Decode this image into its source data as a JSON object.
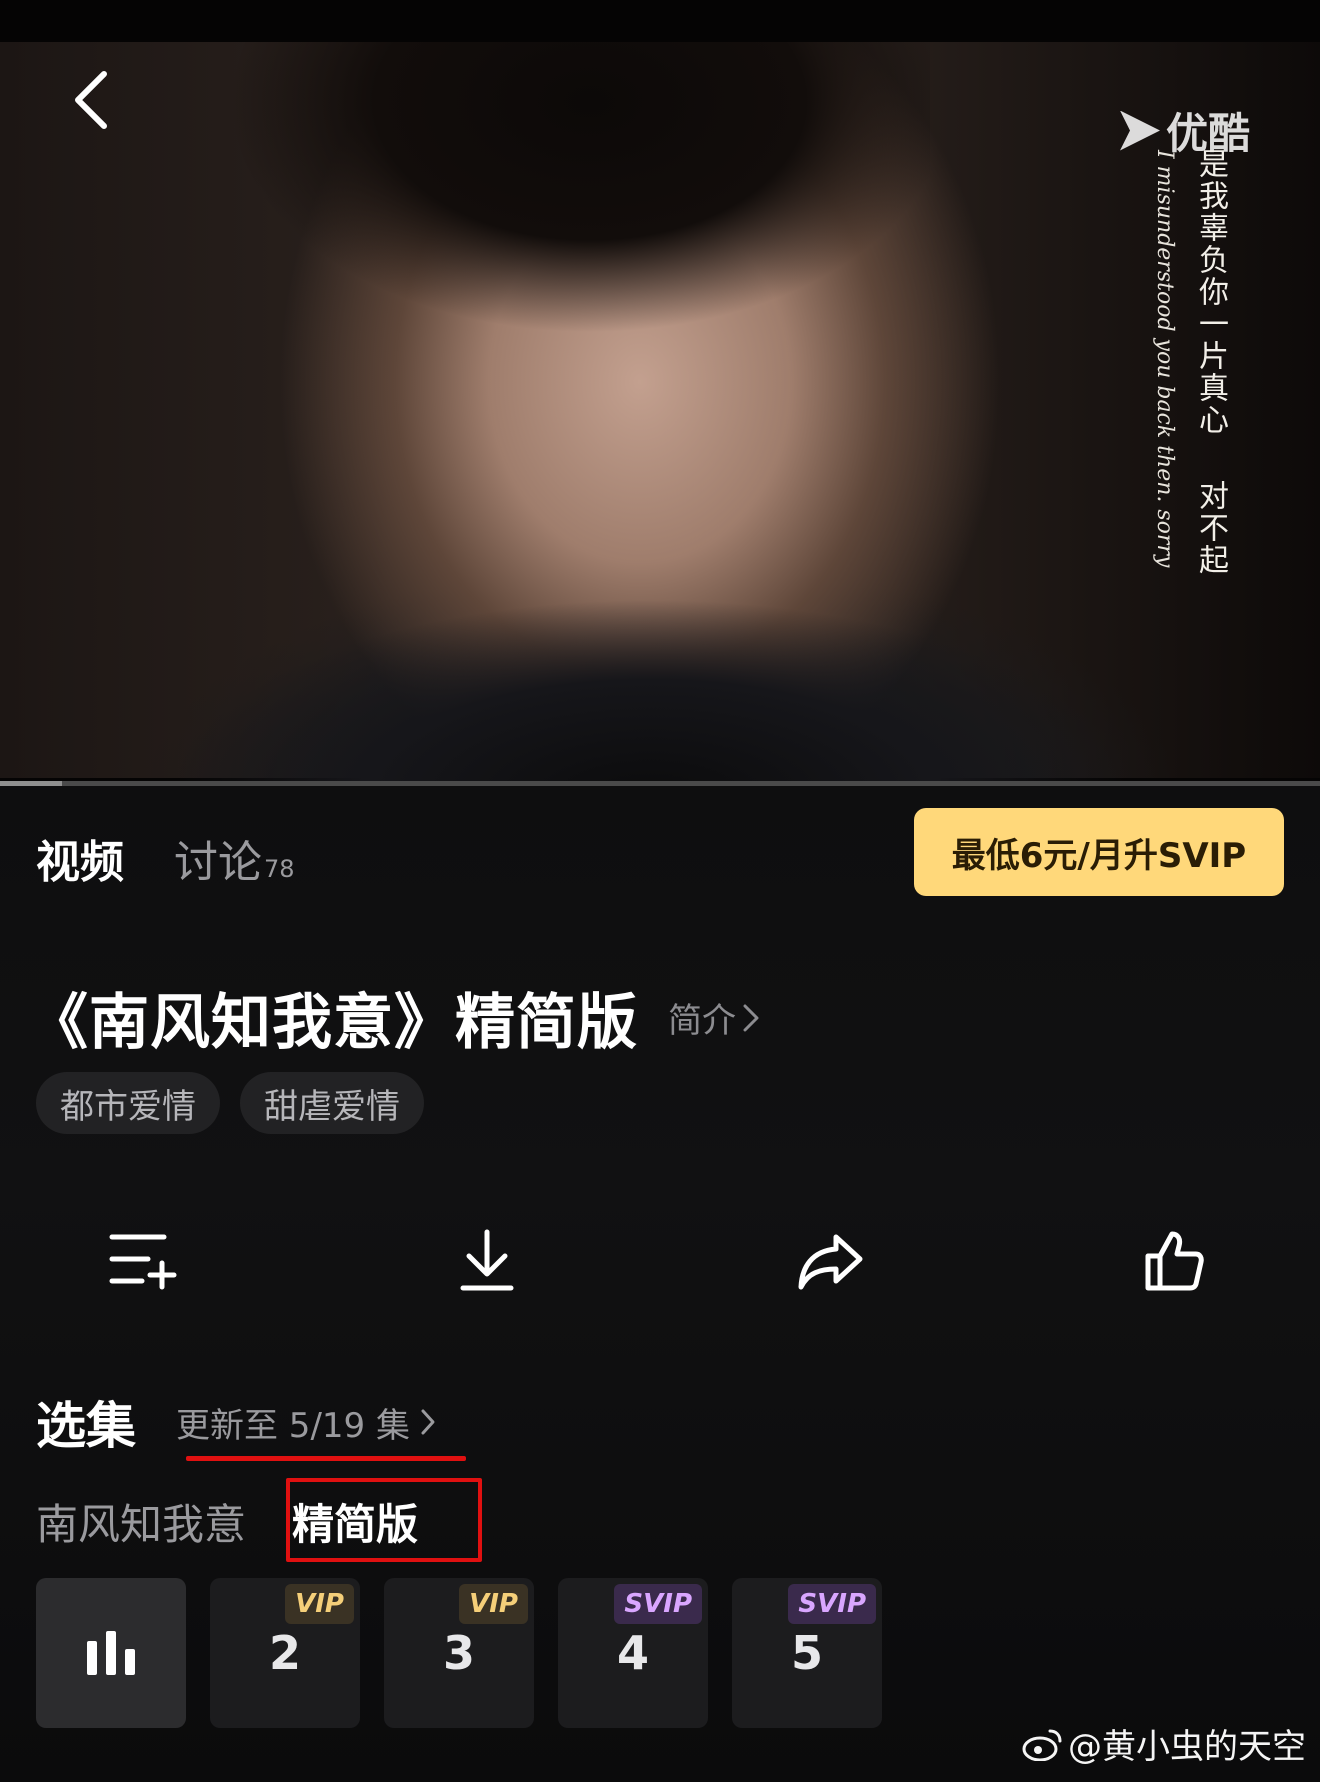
{
  "player": {
    "watermark_text": "优酷",
    "subtitle_cn_top": "是我辜负你一片真心",
    "subtitle_cn_bottom": "对不起",
    "subtitle_en": "I misunderstood you back then. sorry",
    "progress_fraction": 0.047
  },
  "tabs": {
    "video_label": "视频",
    "discussion_label": "讨论",
    "discussion_count": "78"
  },
  "svip_button_label": "最低6元/月升SVIP",
  "show": {
    "title": "《南风知我意》精简版",
    "intro_label": "简介"
  },
  "genres": [
    "都市爱情",
    "甜虐爱情"
  ],
  "actions": [
    "add-to-list-icon",
    "download-icon",
    "share-icon",
    "like-icon"
  ],
  "episodes_section": {
    "title": "选集",
    "update_label": "更新至 5/19 集"
  },
  "versions": {
    "full_label": "南风知我意",
    "condensed_label": "精简版"
  },
  "episodes": [
    {
      "number": "",
      "badge": "",
      "playing": true
    },
    {
      "number": "2",
      "badge": "VIP",
      "playing": false
    },
    {
      "number": "3",
      "badge": "VIP",
      "playing": false
    },
    {
      "number": "4",
      "badge": "SVIP",
      "playing": false
    },
    {
      "number": "5",
      "badge": "SVIP",
      "playing": false
    }
  ],
  "watermark_footer": "@黄小虫的天空",
  "colors": {
    "accent_gold": "#ffd87a",
    "vip_text": "#f5cf79",
    "svip_text": "#d9a6ff",
    "annotation_red": "#e01010"
  }
}
